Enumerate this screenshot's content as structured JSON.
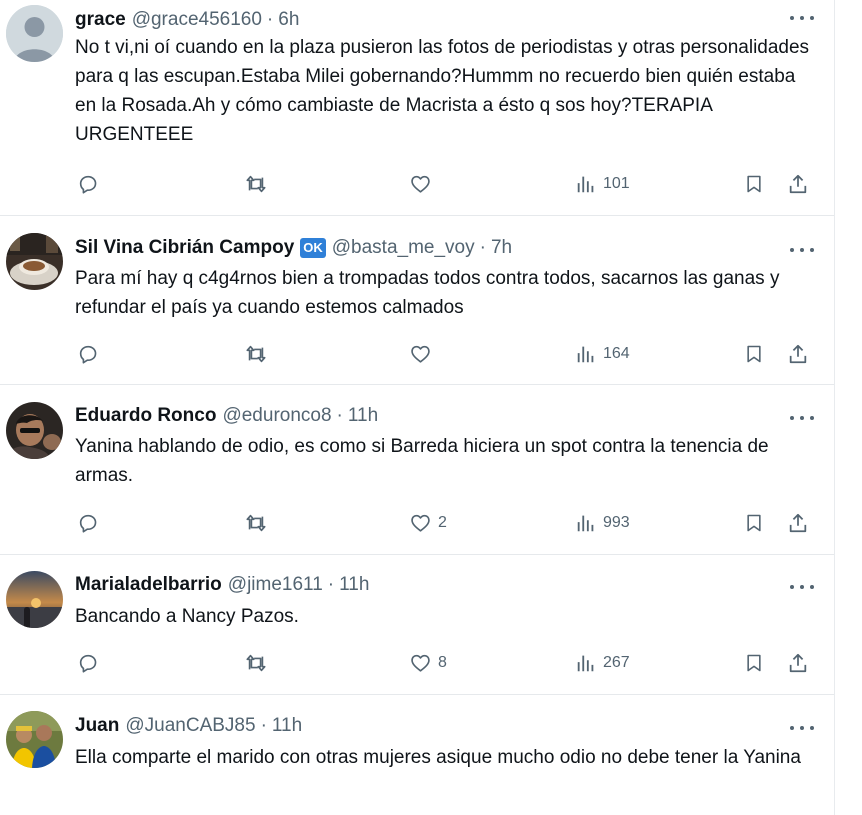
{
  "tweets": [
    {
      "name": "grace",
      "handle": "@grace456160",
      "time": "6h",
      "verified_badge": "",
      "text": "No t vi,ni oí cuando en la plaza pusieron las fotos de periodistas y otras personalidades para q las escupan.Estaba Milei gobernando?Hummm no recuerdo bien quién estaba en la Rosada.Ah y cómo cambiaste de Macrista a ésto q sos hoy?TERAPIA URGENTEEE",
      "likes": "",
      "views": "101",
      "avatar": "default-avatar"
    },
    {
      "name": "Sil Vina Cibrián Campoy",
      "handle": "@basta_me_voy",
      "time": "7h",
      "verified_badge": "OK",
      "text": "Para mí hay q c4g4rnos bien a trompadas todos contra todos, sacarnos las ganas y refundar el país ya cuando estemos calmados",
      "likes": "",
      "views": "164",
      "avatar": "coffee-cup-photo"
    },
    {
      "name": "Eduardo Ronco",
      "handle": "@eduronco8",
      "time": "11h",
      "verified_badge": "",
      "text": "Yanina hablando de odio, es como si Barreda hiciera un spot contra la tenencia de armas.",
      "likes": "2",
      "views": "993",
      "avatar": "person-photo"
    },
    {
      "name": "Marialadelbarrio",
      "handle": "@jime1611",
      "time": "11h",
      "verified_badge": "",
      "text": "Bancando a Nancy Pazos.",
      "likes": "8",
      "views": "267",
      "avatar": "sunset-photo"
    },
    {
      "name": "Juan",
      "handle": "@JuanCABJ85",
      "time": "11h",
      "verified_badge": "",
      "text": "Ella comparte el marido con otras mujeres asique mucho odio no debe tener la Yanina",
      "likes": "",
      "views": "",
      "avatar": "group-photo"
    }
  ],
  "separator": "·",
  "colors": {
    "text": "#0f1419",
    "secondary": "#536471",
    "border": "#e6e9ec",
    "badge": "#2f80d8"
  }
}
